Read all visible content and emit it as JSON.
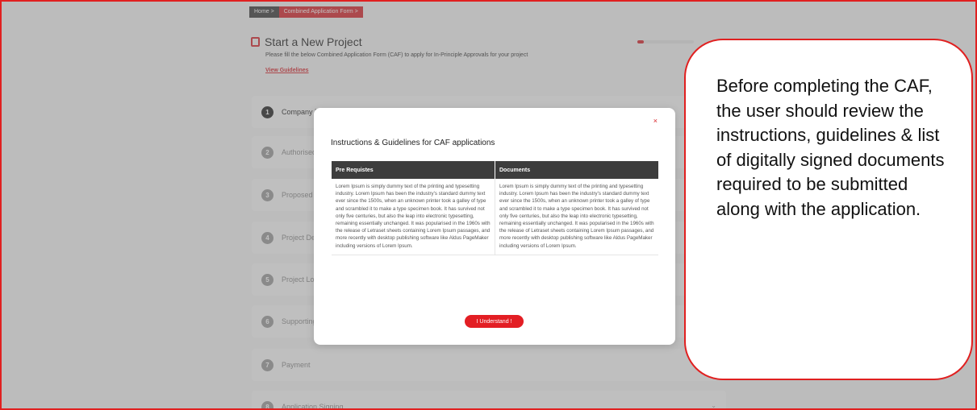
{
  "breadcrumb": {
    "home": "Home",
    "current": "Combined Application Form"
  },
  "project": {
    "title": "Start a New Project",
    "subtitle": "Please fill the below Combined Application Form (CAF) to apply for In-Principle Approvals for your project",
    "guidelines_link": "View Guidelines",
    "progress_fraction": 0.12
  },
  "steps": [
    {
      "num": "1",
      "label": "Company Details"
    },
    {
      "num": "2",
      "label": "Authorised Signatory"
    },
    {
      "num": "3",
      "label": "Proposed Project"
    },
    {
      "num": "4",
      "label": "Project Details"
    },
    {
      "num": "5",
      "label": "Project Location"
    },
    {
      "num": "6",
      "label": "Supporting Documents"
    },
    {
      "num": "7",
      "label": "Payment"
    },
    {
      "num": "8",
      "label": "Application Signing"
    }
  ],
  "modal": {
    "close": "×",
    "title": "Instructions & Guidelines for CAF applications",
    "col1_header": "Pre Requistes",
    "col2_header": "Documents",
    "col1_text": "Lorem Ipsum is simply dummy text of the printing and typesetting industry. Lorem Ipsum has been the industry's standard dummy text ever since the 1500s, when an unknown printer took a galley of type and scrambled it to make a type specimen book. It has survived not only five centuries, but also the leap into electronic typesetting, remaining essentially unchanged. It was popularised in the 1960s with the release of Letraset sheets containing Lorem Ipsum passages, and more recently with desktop publishing software like Aldus PageMaker including versions of Lorem Ipsum.",
    "col2_text": "Lorem Ipsum is simply dummy text of the printing and typesetting industry. Lorem Ipsum has been the industry's standard dummy text ever since the 1500s, when an unknown printer took a galley of type and scrambled it to make a type specimen book. It has survived not only five centuries, but also the leap into electronic typesetting, remaining essentially unchanged. It was popularised in the 1960s with the release of Letraset sheets containing Lorem Ipsum passages, and more recently with desktop publishing software like Aldus PageMaker including versions of Lorem Ipsum.",
    "button": "I Understand !"
  },
  "callout": {
    "text": "Before completing the CAF, the user should review the instructions, guidelines & list of digitally signed documents required to be submitted along with the application."
  },
  "colors": {
    "accent": "#d8232a",
    "header": "#3d3d3d",
    "callout_border": "#e02020"
  }
}
